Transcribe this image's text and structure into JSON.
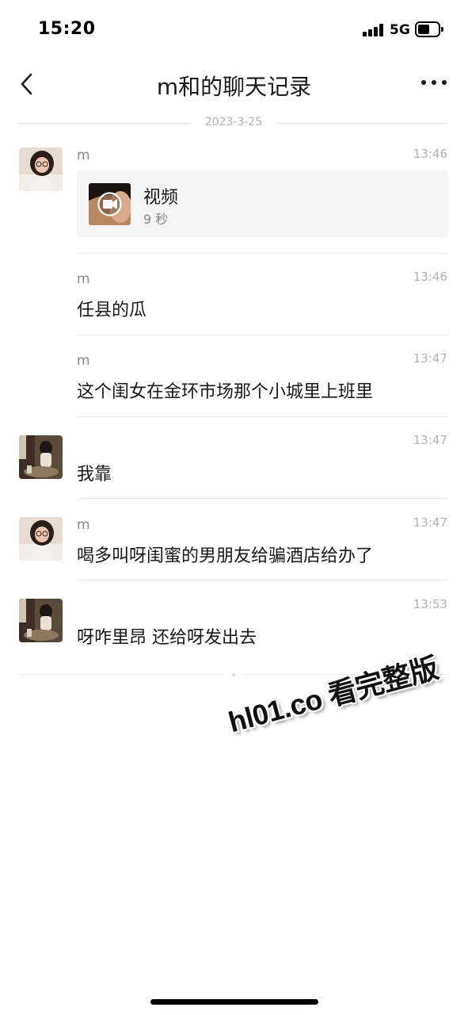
{
  "status_bar": {
    "time": "15:20",
    "network": "5G"
  },
  "header": {
    "title": "m和的聊天记录"
  },
  "date_separator": "2023-3-25",
  "messages": [
    {
      "sender": "m",
      "time": "13:46",
      "type": "video",
      "video_label": "视频",
      "video_duration": "9 秒",
      "avatar": "woman-glasses-avatar"
    },
    {
      "sender": "m",
      "time": "13:46",
      "text": "任县的瓜"
    },
    {
      "sender": "m",
      "time": "13:47",
      "text": "这个闺女在金环市场那个小城里上班里"
    },
    {
      "sender": "",
      "time": "13:47",
      "text": "我靠",
      "avatar": "seated-person-avatar"
    },
    {
      "sender": "m",
      "time": "13:47",
      "text": "喝多叫呀闺蜜的男朋友给骗酒店给办了",
      "avatar": "woman-glasses-avatar"
    },
    {
      "sender": "",
      "time": "13:53",
      "text": "呀咋里昂 还给呀发出去",
      "avatar": "seated-person-avatar"
    }
  ],
  "watermark": "hl01.co 看完整版",
  "colors": {
    "text": "#191919",
    "meta": "#888888",
    "time": "#b2b2b2",
    "card_bg": "#f5f5f5"
  }
}
